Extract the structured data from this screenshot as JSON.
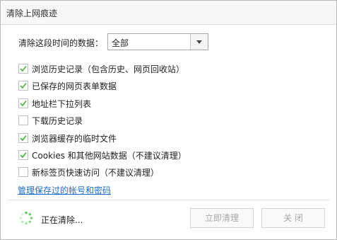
{
  "dialog": {
    "title": "清除上网痕迹"
  },
  "range": {
    "label": "清除这段时间的数据：",
    "selected": "全部"
  },
  "options": [
    {
      "label": "浏览历史记录（包含历史、网页回收站）",
      "checked": true
    },
    {
      "label": "已保存的网页表单数据",
      "checked": true
    },
    {
      "label": "地址栏下拉列表",
      "checked": true
    },
    {
      "label": "下载历史记录",
      "checked": false
    },
    {
      "label": "浏览器缓存的临时文件",
      "checked": true
    },
    {
      "label": "Cookies 和其他网站数据（不建议清理）",
      "checked": true
    },
    {
      "label": "新标签页快速访问（不建议清理）",
      "checked": false
    }
  ],
  "manage_link": "管理保存过的帐号和密码",
  "footer": {
    "status": "正在清除...",
    "clear_label": "立即清理",
    "close_label": "关 闭"
  },
  "colors": {
    "check": "#52b847",
    "link": "#1b6ecf",
    "spinner": "#5cc85a"
  }
}
